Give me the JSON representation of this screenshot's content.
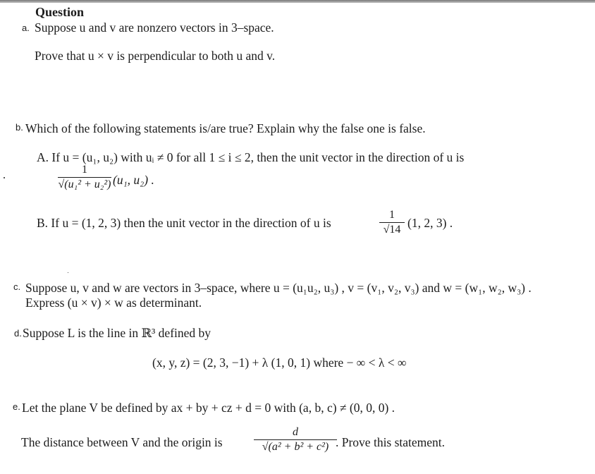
{
  "heading": "Question",
  "a": {
    "label": "a.",
    "line1": "Suppose u and v are nonzero vectors in 3–space.",
    "line2": "Prove that u × v is perpendicular to both u and v."
  },
  "b": {
    "label": "b.",
    "question": "Which of the following statements is/are true?  Explain why the false one is false.",
    "A": {
      "line1": "A.  If u = (u₁, u₂) with uᵢ ≠ 0 for all 1 ≤ i ≤ 2, then the unit vector in the direction of u is",
      "frac_num": "1",
      "frac_den": "√(u₁² + u₂²)",
      "tail": "(u₁,  u₂) ."
    },
    "B": {
      "line1": "B.  If u = (1, 2, 3) then the unit vector in the direction of u is",
      "frac_num": "1",
      "frac_den": "√14",
      "tail": "(1, 2, 3) ."
    }
  },
  "c": {
    "label": "c.",
    "line1": "Suppose u,  v and w are vectors in 3–space,  where u = (u₁u₂, u₃) ,  v = (v₁, v₂, v₃) and w = (w₁, w₂, w₃) .",
    "line2": "Express (u × v) × w as determinant."
  },
  "d": {
    "label": "d.",
    "line1": "Suppose L is the line in ℝ³ defined by",
    "equation": "(x, y, z) = (2, 3, −1) + λ (1, 0, 1)  where  − ∞ < λ < ∞"
  },
  "e": {
    "label": "e.",
    "line1": "Let the plane V  be defined by ax + by + cz + d = 0 with (a, b, c) ≠ (0, 0, 0) .",
    "line2": "The distance between V  and the origin is",
    "frac_num": "d",
    "frac_den": "√(a² + b² + c²)",
    "tail": ".   Prove this statement."
  }
}
